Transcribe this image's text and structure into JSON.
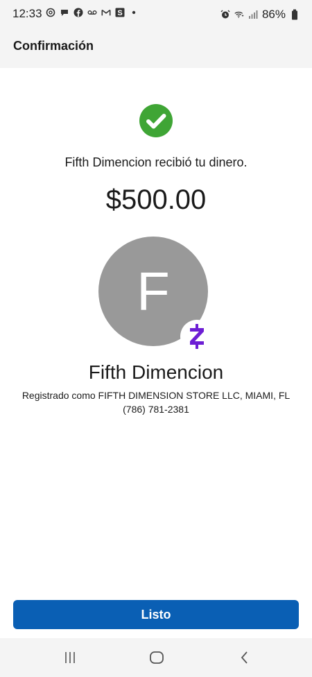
{
  "status_bar": {
    "time": "12:33",
    "battery_percent": "86%",
    "icons_left": [
      "threads-icon",
      "chat-bubble-icon",
      "facebook-icon",
      "voicemail-icon",
      "gmail-icon",
      "s-app-icon",
      "dot-icon"
    ],
    "icons_right": [
      "alarm-icon",
      "wifi-icon",
      "signal-icon",
      "battery-icon"
    ]
  },
  "header": {
    "title": "Confirmación"
  },
  "confirmation": {
    "message": "Fifth Dimencion recibió tu dinero.",
    "amount": "$500.00"
  },
  "recipient": {
    "avatar_letter": "F",
    "name": "Fifth Dimencion",
    "registered_as": "Registrado como FIFTH DIMENSION STORE LLC, MIAMI, FL",
    "phone": "(786) 781-2381"
  },
  "actions": {
    "done_label": "Listo"
  },
  "colors": {
    "success_green": "#3fa535",
    "primary_blue": "#0a5fb4",
    "zelle_purple": "#6d1ed4",
    "avatar_gray": "#999999"
  }
}
